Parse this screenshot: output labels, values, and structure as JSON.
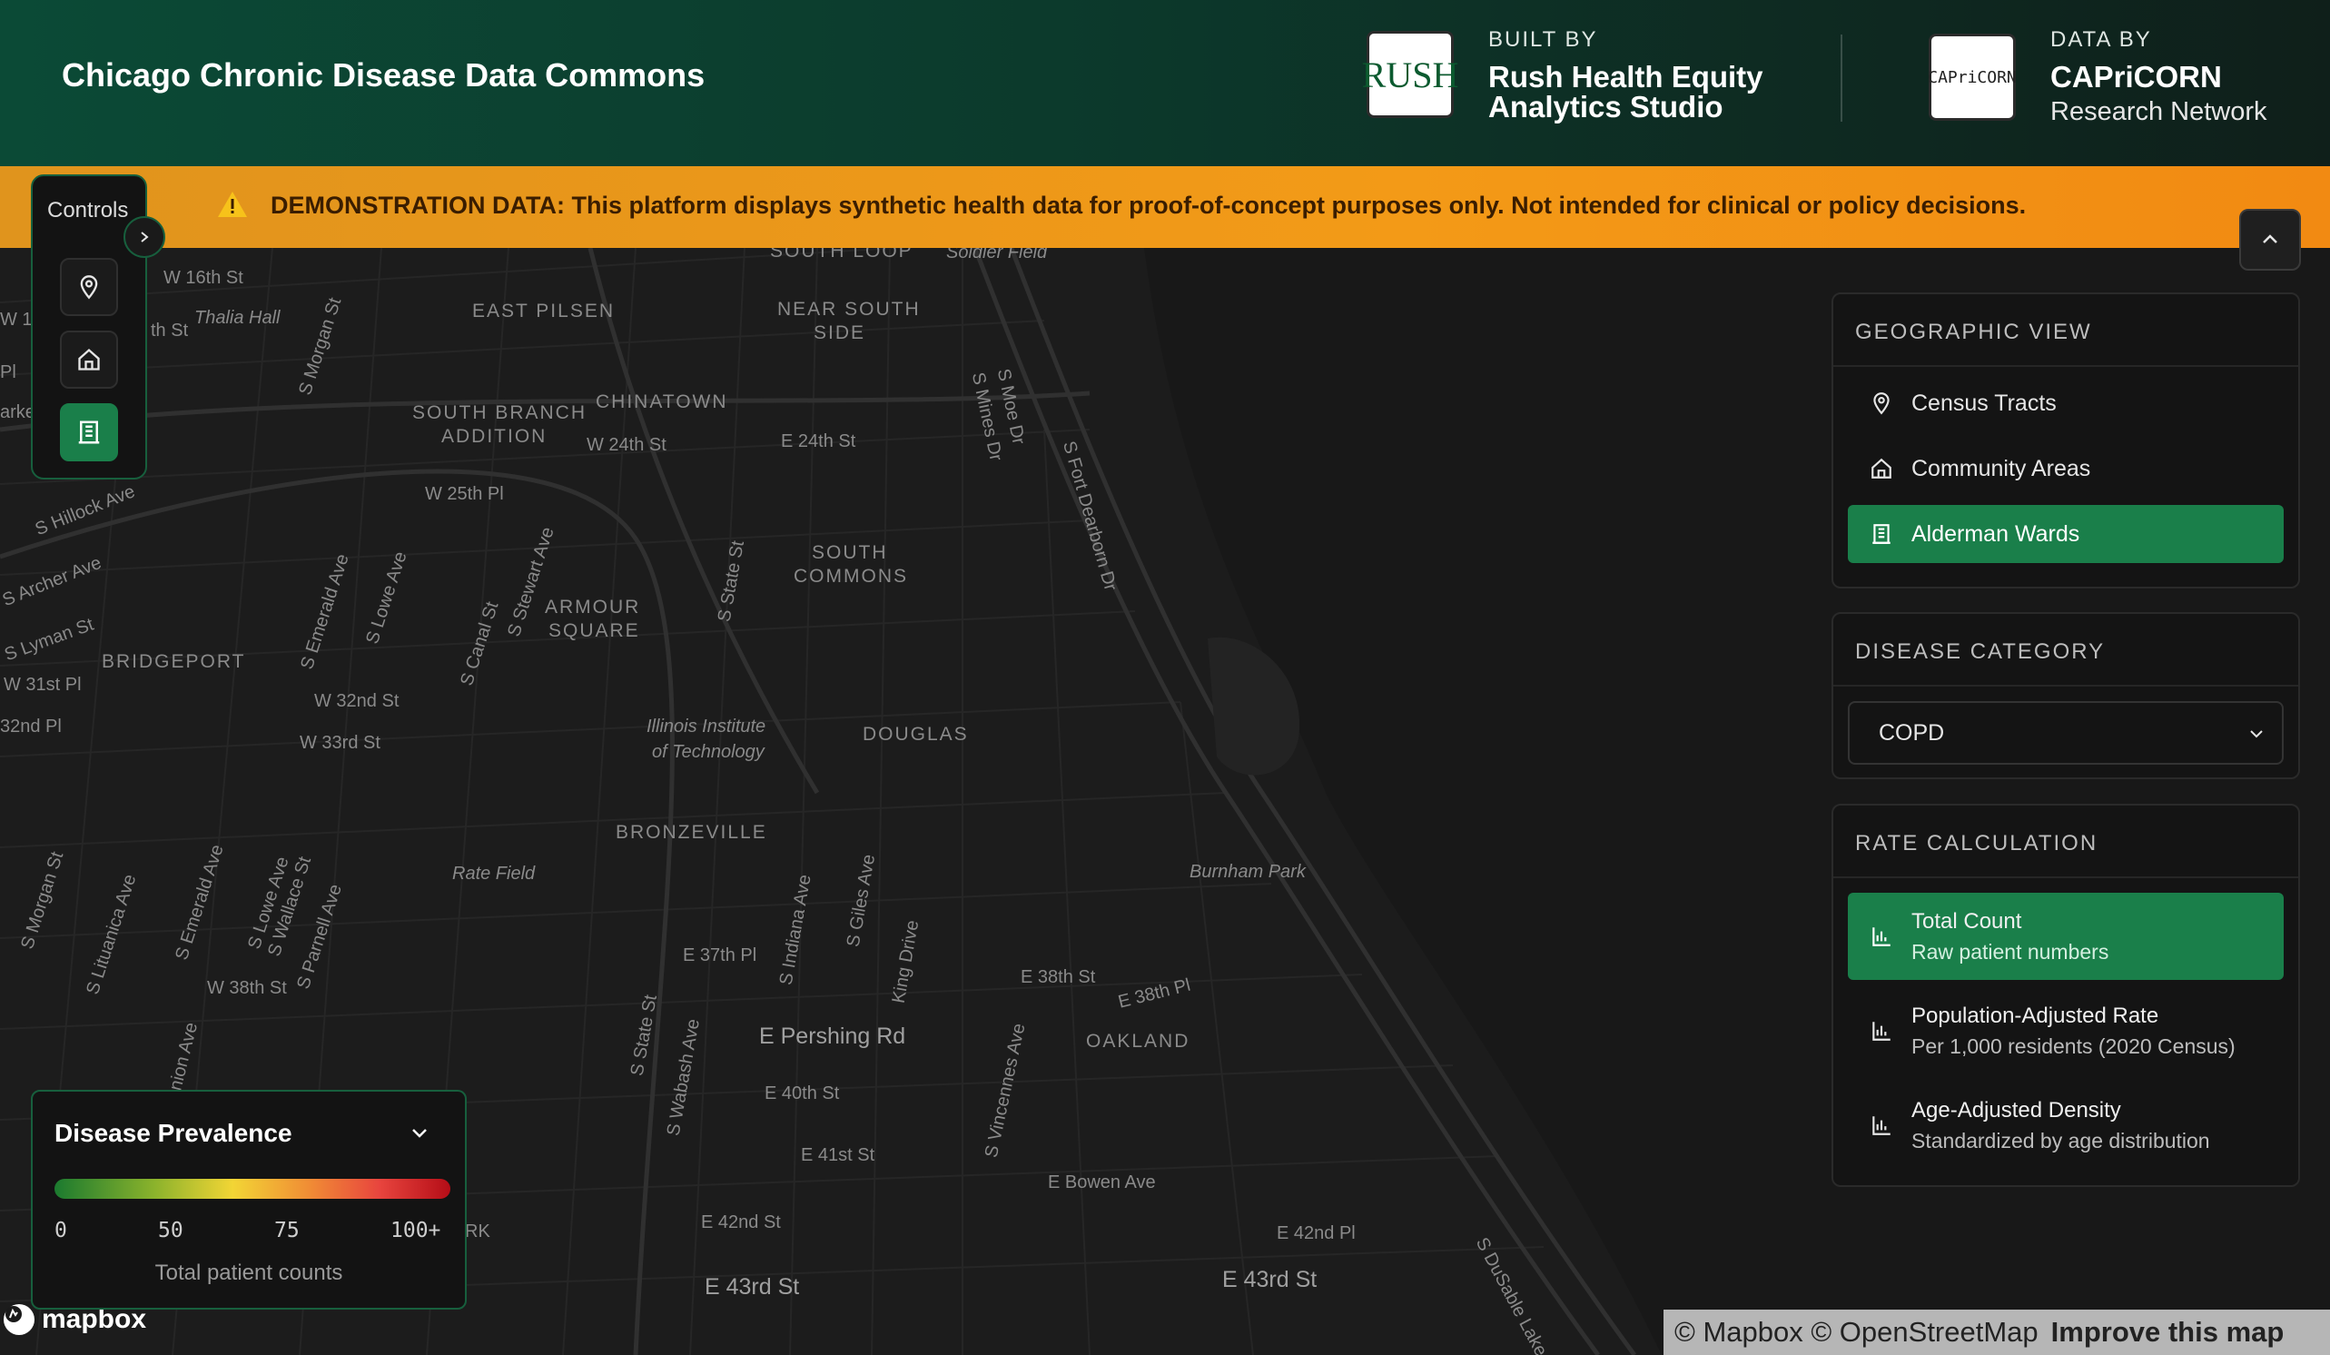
{
  "header": {
    "title": "Chicago Chronic Disease Data Commons",
    "built_by": {
      "kicker": "BUILT BY",
      "name": "Rush Health Equity Analytics Studio",
      "logo_text": "RUSH"
    },
    "data_by": {
      "kicker": "DATA BY",
      "name": "CAPriCORN",
      "sub": "Research Network",
      "logo_text": "CAPriCORN"
    }
  },
  "banner": {
    "text": "DEMONSTRATION DATA: This platform displays synthetic health data for proof-of-concept purposes only. Not intended for clinical or policy decisions."
  },
  "controls": {
    "title": "Controls",
    "buttons": [
      {
        "icon": "map-pin-icon",
        "active": false
      },
      {
        "icon": "home-icon",
        "active": false
      },
      {
        "icon": "building-icon",
        "active": true
      }
    ]
  },
  "geographic_view": {
    "title": "GEOGRAPHIC VIEW",
    "options": [
      {
        "label": "Census Tracts",
        "icon": "map-pin-icon",
        "active": false
      },
      {
        "label": "Community Areas",
        "icon": "home-icon",
        "active": false
      },
      {
        "label": "Alderman Wards",
        "icon": "building-icon",
        "active": true
      }
    ]
  },
  "disease_category": {
    "title": "DISEASE CATEGORY",
    "selected": "COPD"
  },
  "rate_calculation": {
    "title": "RATE CALCULATION",
    "options": [
      {
        "label": "Total Count",
        "sub": "Raw patient numbers",
        "active": true
      },
      {
        "label": "Population-Adjusted Rate",
        "sub": "Per 1,000 residents (2020 Census)",
        "active": false
      },
      {
        "label": "Age-Adjusted Density",
        "sub": "Standardized by age distribution",
        "active": false
      }
    ]
  },
  "legend": {
    "title": "Disease Prevalence",
    "ticks": [
      "0",
      "50",
      "75",
      "100+"
    ],
    "note": "Total patient counts"
  },
  "map": {
    "labels": {
      "w16th": "W 16th St",
      "thalia": "Thalia Hall",
      "eastpilsen": "EAST PILSEN",
      "nearsouth1": "NEAR SOUTH",
      "nearsouth2": "SIDE",
      "southloop": "SOUTH LOOP",
      "soldier": "Soldier Field",
      "chinatown": "CHINATOWN",
      "sbranch1": "SOUTH BRANCH",
      "sbranch2": "ADDITION",
      "w24th": "W 24th St",
      "e24th": "E 24th St",
      "w25th": "W 25th Pl",
      "hillock": "S Hillock Ave",
      "archer": "S Archer Ave",
      "lyman": "S Lyman St",
      "bridgeport": "BRIDGEPORT",
      "w31stpl": "W 31st Pl",
      "n32ndpl": "32nd Pl",
      "w32nd": "W 32nd St",
      "w33rd": "W 33rd St",
      "armour1": "ARMOUR",
      "armour2": "SQUARE",
      "scommons1": "SOUTH",
      "scommons2": "COMMONS",
      "iit1": "Illinois Institute",
      "iit2": "of Technology",
      "douglas": "DOUGLAS",
      "bronzeville": "BRONZEVILLE",
      "ratefield": "Rate Field",
      "burnham": "Burnham Park",
      "w38th": "W 38th St",
      "e37thpl": "E 37th Pl",
      "e38th": "E 38th St",
      "e38thpl": "E 38th Pl",
      "pershing": "E Pershing Rd",
      "oakland": "OAKLAND",
      "e40th": "E 40th St",
      "e41st": "E 41st St",
      "bowen": "E Bowen Ave",
      "e42nd": "E 42nd St",
      "e42ndpl": "E 42nd Pl",
      "e43rd": "E 43rd St",
      "e43rd2": "E 43rd St",
      "dusable": "S DuSable Lake",
      "ftdearborn": "S Fort Dearborn Dr",
      "smoe": "S Moe Dr",
      "smines": "S Mines Dr",
      "sstate": "S State St",
      "sstate2": "S State St",
      "smorgan": "S Morgan St",
      "smorgan2": "S Morgan St",
      "semerald": "S Emerald Ave",
      "semerald2": "S Emerald Ave",
      "slowe": "S Lowe Ave",
      "slowe2": "S Lowe Ave",
      "scanal": "S Canal St",
      "sstewart": "S Stewart Ave",
      "slituanica": "S Lituanica Ave",
      "swallace": "S Wallace St",
      "sparnell": "S Parnell Ave",
      "sindiana": "S Indiana Ave",
      "sgiles": "S Giles Ave",
      "kingdrive": "King Drive",
      "swabash": "S Wabash Ave",
      "svincennes": "S Vincennes Ave",
      "union": "Union Ave",
      "rk": "RK",
      "pl": "Pl",
      "arke": "arke",
      "w1": "W 1",
      "thst": "th St"
    }
  },
  "attribution": {
    "mapbox_word": "mapbox",
    "credits": "© Mapbox © OpenStreetMap",
    "improve": "Improve this map"
  }
}
